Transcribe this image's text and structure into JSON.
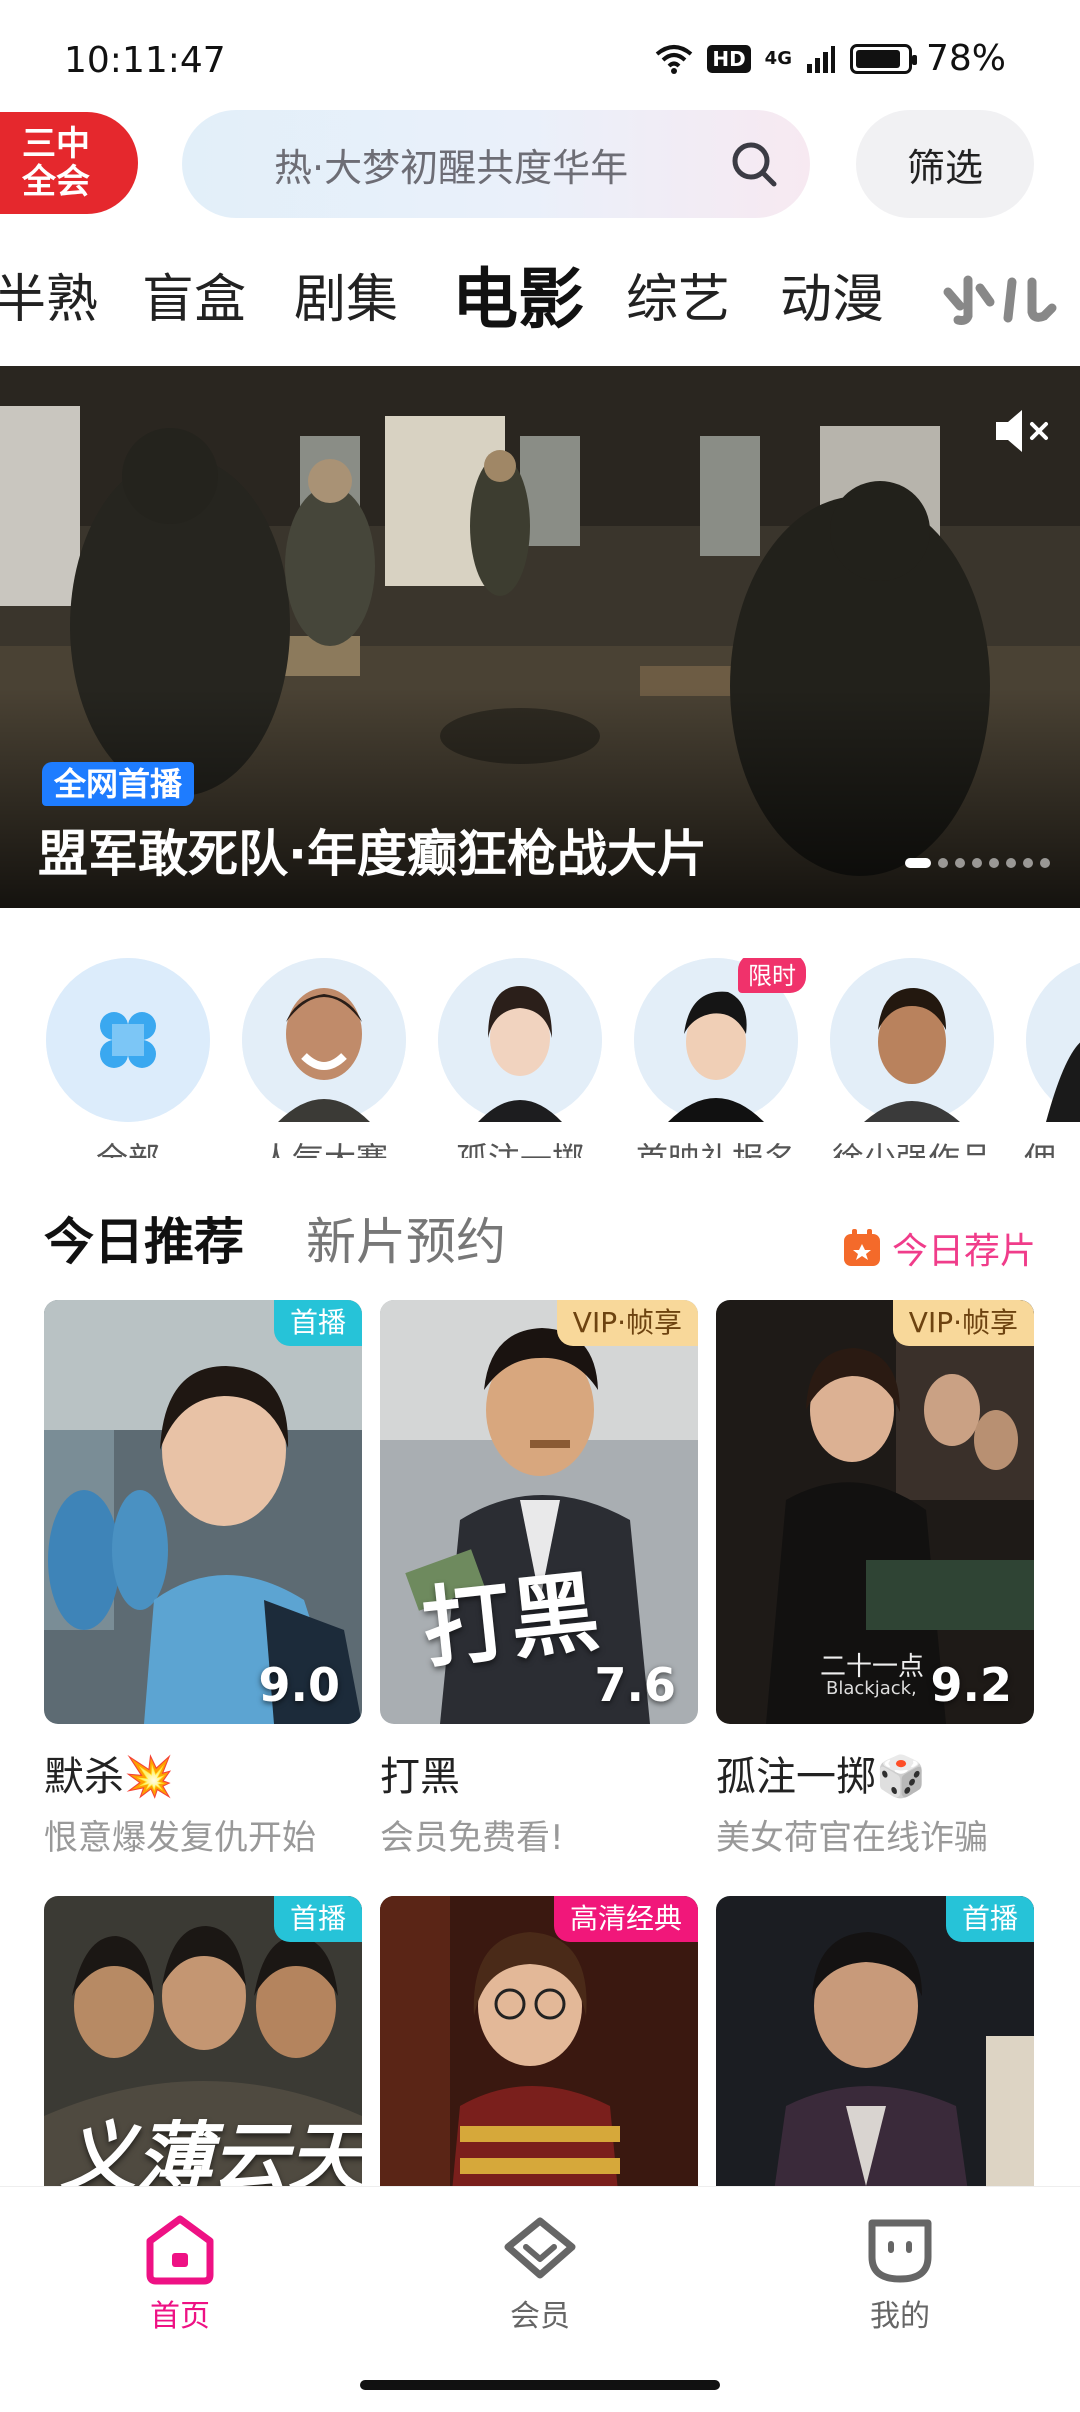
{
  "status_bar": {
    "time": "10:11:47",
    "hd": "HD",
    "network": "4G",
    "battery": "78%",
    "battery_level": 0.78
  },
  "header": {
    "event_badge_line1": "三中",
    "event_badge_line2": "全会",
    "search_placeholder": "热·大梦初醒共度华年",
    "filter_label": "筛选"
  },
  "categories": [
    {
      "label": "半熟"
    },
    {
      "label": "盲盒"
    },
    {
      "label": "剧集"
    },
    {
      "label": "电影",
      "active": true
    },
    {
      "label": "综艺"
    },
    {
      "label": "动漫"
    },
    {
      "label": "少儿",
      "logo": true
    }
  ],
  "banner": {
    "tag": "全网首播",
    "title": "盟军敢死队·年度癫狂枪战大片",
    "slide_count": 8,
    "active_slide": 0
  },
  "quick_access": [
    {
      "label": "全部",
      "icon": "grid-icon"
    },
    {
      "label": "人气大赛"
    },
    {
      "label": "孤注一掷"
    },
    {
      "label": "首映礼报名",
      "badge": "限时"
    },
    {
      "label": "徐少强作品"
    },
    {
      "label": "佣"
    }
  ],
  "recommend": {
    "tab_active": "今日推荐",
    "tab_inactive": "新片预约",
    "link_label": "今日荐片"
  },
  "cards": [
    {
      "title": "默杀💥",
      "subtitle": "恨意爆发复仇开始",
      "tag": "首播",
      "score": "9.0"
    },
    {
      "title": "打黑",
      "subtitle": "会员免费看!",
      "tag": "VIP·帧享",
      "score": "7.6",
      "poster_text": "打黑"
    },
    {
      "title": "孤注一掷🎲",
      "subtitle": "美女荷官在线诈骗",
      "tag": "VIP·帧享",
      "score": "9.2",
      "poster_text": "二十一点",
      "poster_text2": "Blackjack,"
    },
    {
      "title": "",
      "subtitle": "",
      "tag": "首播",
      "score": "",
      "poster_text": "义薄云天"
    },
    {
      "title": "",
      "subtitle": "",
      "tag": "高清经典",
      "score": ""
    },
    {
      "title": "",
      "subtitle": "",
      "tag": "首播",
      "score": ""
    }
  ],
  "bottom_nav": [
    {
      "label": "首页",
      "active": true
    },
    {
      "label": "会员"
    },
    {
      "label": "我的"
    }
  ],
  "colors": {
    "accent_pink": "#ee1184",
    "tag_cyan": "#26c3d8",
    "tag_gold": "#f8d89a",
    "event_red": "#e5282d",
    "banner_tag_blue": "#1e7cff"
  }
}
